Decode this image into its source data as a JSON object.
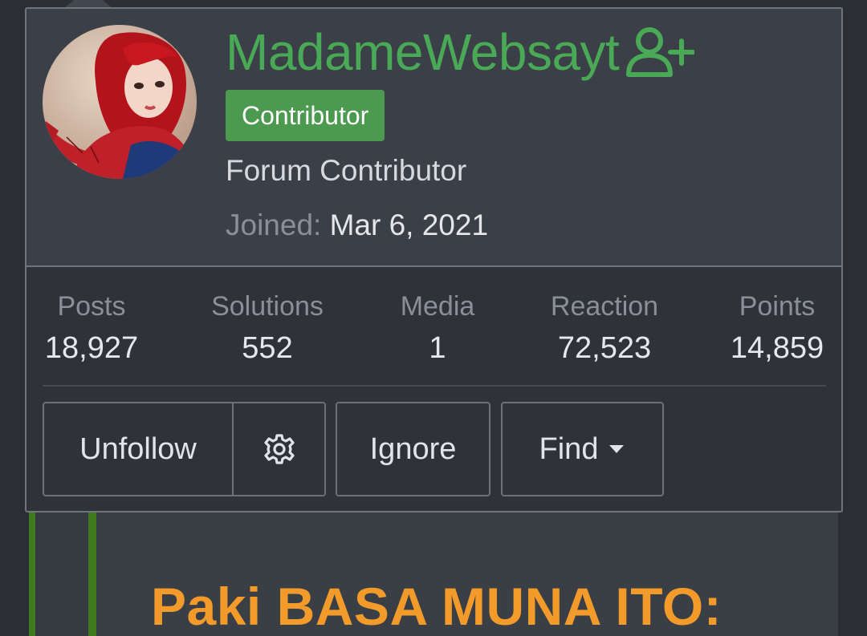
{
  "background": {
    "heading": "Paki BASA MUNA ITO:"
  },
  "profile": {
    "username": "MadameWebsayt",
    "follow_icon": "user-plus-icon",
    "badge": "Contributor",
    "title": "Forum Contributor",
    "joined_label": "Joined:",
    "joined_value": "Mar 6, 2021"
  },
  "stats": [
    {
      "label": "Posts",
      "value": "18,927"
    },
    {
      "label": "Solutions",
      "value": "552"
    },
    {
      "label": "Media",
      "value": "1"
    },
    {
      "label": "Reaction",
      "value": "72,523"
    },
    {
      "label": "Points",
      "value": "14,859"
    }
  ],
  "actions": {
    "unfollow": "Unfollow",
    "settings_icon": "gear-icon",
    "ignore": "Ignore",
    "find": "Find",
    "find_icon": "caret-down-icon"
  },
  "colors": {
    "username": "#4aa956",
    "badge_bg": "#4b9a50",
    "heading": "#f29b2b",
    "accent_bar": "#3f7a1e"
  }
}
